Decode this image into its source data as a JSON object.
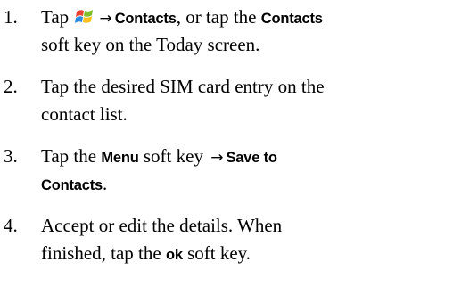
{
  "steps": [
    {
      "number": "1.",
      "lines": [
        {
          "t1": "Tap ",
          "icon": "windows-start-flag-icon",
          "arrow": "→",
          "k1": "Contacts",
          "t2": ", or tap the ",
          "k2": "Contacts"
        },
        {
          "t1": "soft key on the Today screen."
        }
      ]
    },
    {
      "number": "2.",
      "lines": [
        {
          "t1": "Tap the desired SIM card entry on the"
        },
        {
          "t1": "contact list."
        }
      ]
    },
    {
      "number": "3.",
      "lines": [
        {
          "t1": "Tap the ",
          "k1": "Menu",
          "t2": " soft key ",
          "arrow": "→",
          "k2": "Save to"
        },
        {
          "k1": "Contacts",
          "t1": "."
        }
      ]
    },
    {
      "number": "4.",
      "lines": [
        {
          "t1": "Accept or edit the details. When"
        },
        {
          "t1": "finished, tap the ",
          "k1": "ok",
          "t2": " soft key."
        }
      ]
    }
  ],
  "colors": {
    "text": "#000000",
    "background": "#ffffff",
    "flag_red": "#e8452c",
    "flag_green": "#7cbf2a",
    "flag_blue": "#2a8be0",
    "flag_yellow": "#f7c21b"
  }
}
